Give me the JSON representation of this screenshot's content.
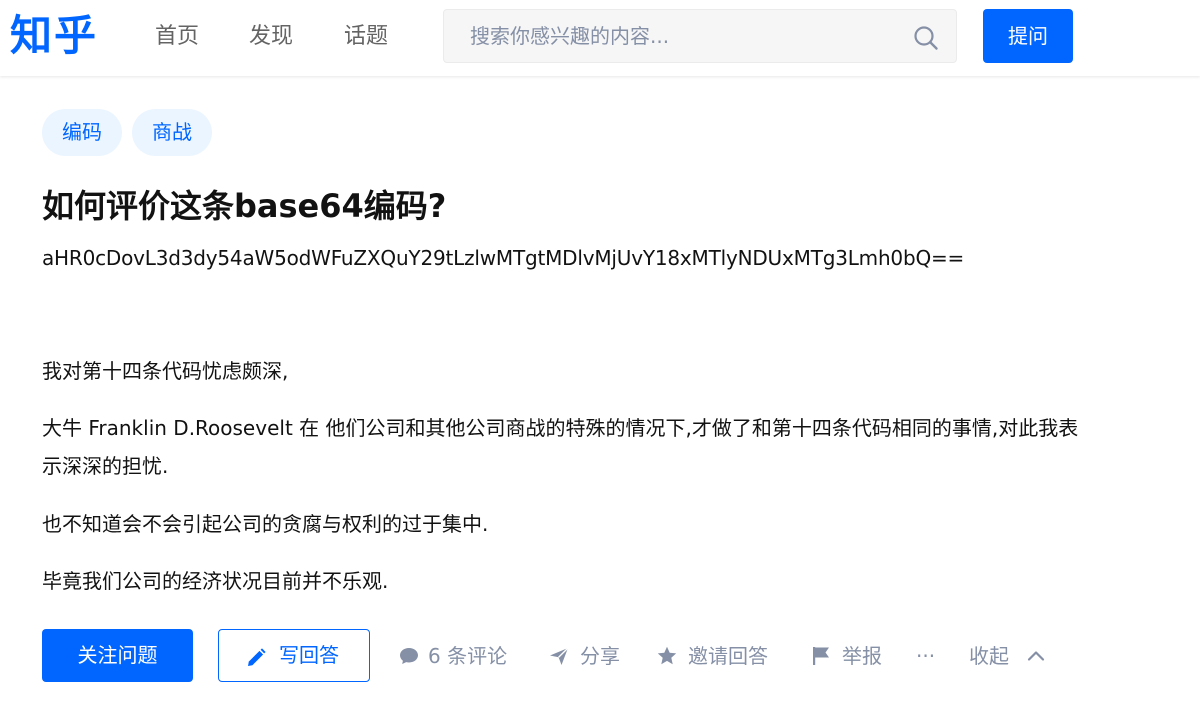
{
  "header": {
    "logo": "知乎",
    "nav": [
      "首页",
      "发现",
      "话题"
    ],
    "search_placeholder": "搜索你感兴趣的内容...",
    "ask_label": "提问"
  },
  "question": {
    "tags": [
      "编码",
      "商战"
    ],
    "title": "如何评价这条base64编码?",
    "encoded": "aHR0cDovL3d3dy54aW5odWFuZXQuY29tLzlwMTgtMDlvMjUvY18xMTlyNDUxMTg3Lmh0bQ==",
    "paragraphs": [
      "我对第十四条代码忧虑颇深,",
      "大牛 Franklin D.Roosevelt 在 他们公司和其他公司商战的特殊的情况下,才做了和第十四条代码相同的事情,对此我表示深深的担忧.",
      "也不知道会不会引起公司的贪腐与权利的过于集中.",
      "毕竟我们公司的经济状况目前并不乐观."
    ]
  },
  "actions": {
    "follow_label": "关注问题",
    "answer_label": "写回答",
    "comments_label": "6 条评论",
    "share_label": "分享",
    "invite_label": "邀请回答",
    "report_label": "举报",
    "more_label": "···",
    "collapse_label": "收起"
  },
  "colors": {
    "brand": "#0066ff",
    "tag_bg": "#ebf5ff",
    "muted": "#8590a6"
  }
}
